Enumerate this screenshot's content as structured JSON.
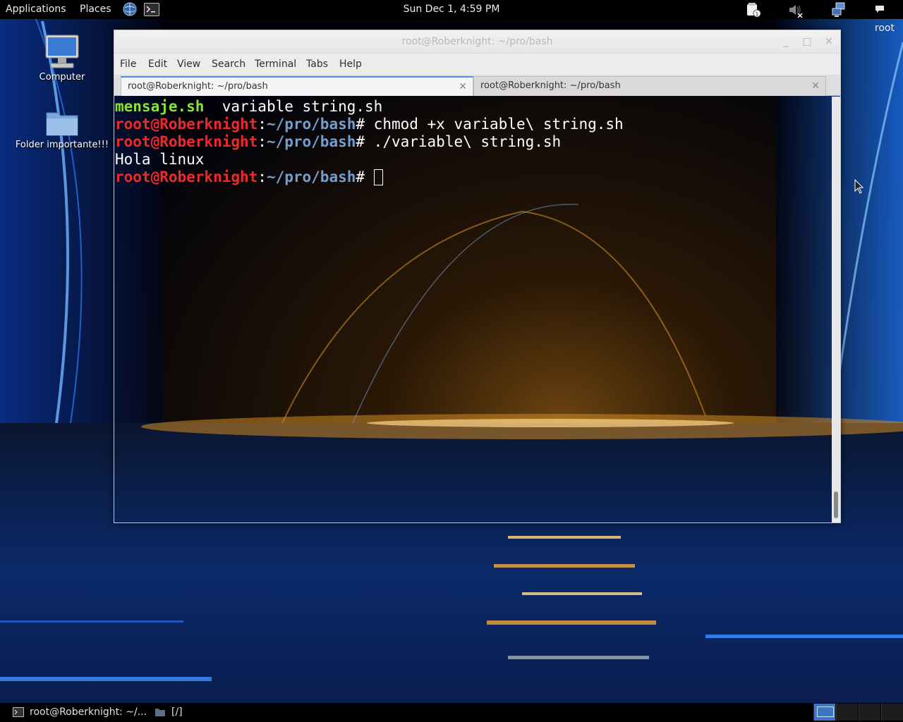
{
  "top_panel": {
    "applications_label": "Applications",
    "places_label": "Places",
    "clock": "Sun Dec  1,  4:59 PM",
    "user": "root"
  },
  "desktop": {
    "icons": [
      {
        "label": "Computer",
        "icon": "computer-icon"
      },
      {
        "label": "Folder importante!!!",
        "icon": "folder-icon"
      }
    ]
  },
  "terminal_window": {
    "title": "root@Roberknight: ~/pro/bash",
    "menu": [
      "File",
      "Edit",
      "View",
      "Search",
      "Terminal",
      "Tabs",
      "Help"
    ],
    "tabs": [
      {
        "label": "root@Roberknight: ~/pro/bash",
        "active": true
      },
      {
        "label": "root@Roberknight: ~/pro/bash",
        "active": false
      }
    ],
    "lines": {
      "l1": {
        "file1": "mensaje.sh",
        "file2": "  variable string.sh"
      },
      "l2": {
        "user": "root@Roberknight",
        "sep": ":",
        "path": "~/pro/bash",
        "cmd": "# chmod +x variable\\ string.sh"
      },
      "l3": {
        "user": "root@Roberknight",
        "sep": ":",
        "path": "~/pro/bash",
        "cmd": "# ./variable\\ string.sh"
      },
      "l4": {
        "output": "Hola linux"
      },
      "l5": {
        "user": "root@Roberknight",
        "sep": ":",
        "path": "~/pro/bash",
        "cmd": "# "
      }
    }
  },
  "bottom_panel": {
    "tasks": [
      {
        "label": "root@Roberknight: ~/...",
        "icon": "terminal-icon"
      },
      {
        "label": "[/]",
        "icon": "folder-icon"
      }
    ]
  },
  "colors": {
    "prompt_user": "#ef2929",
    "prompt_path": "#729fcf",
    "executable": "#8ae234",
    "active_workspace": "#3d76c4"
  }
}
